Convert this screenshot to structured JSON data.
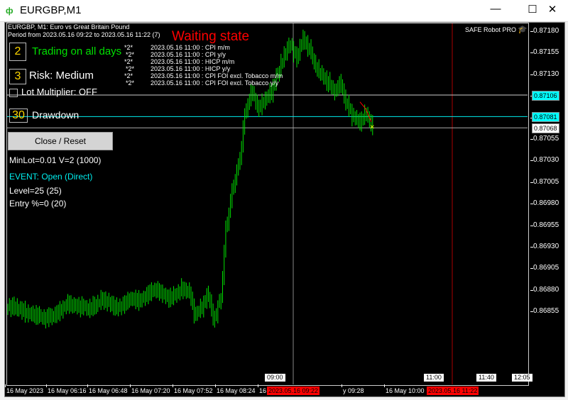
{
  "window": {
    "title": "EURGBP,M1",
    "minimize": "—",
    "maximize": "☐",
    "close": "✕",
    "icon": "candlestick-icon"
  },
  "chart": {
    "symbol_line": "EURGBP, M1:  Euro vs Great Britain Pound",
    "period_line": "Period from  2023.05.16 09:22      to 2023.05.16 11:22   (7)",
    "state": "Waiting state",
    "robot": "SAFE Robot PRO",
    "robot_icon": "graduation-cap-icon",
    "trading_box": "2",
    "trading_label": "Trading on all days",
    "risk_box": "3",
    "risk_label": "Risk: Medium",
    "lot_label": "Lot Multiplier: OFF",
    "dd_box": "30",
    "dd_label": "Drawdown",
    "close_button": "Close / Reset",
    "minlot": "MinLot=0.01    V=2 (1000)",
    "event": "EVENT: Open (Direct)",
    "level": "Level=25 (25)",
    "entry": "Entry %=0 (20)",
    "news": [
      {
        "mark": "*2*",
        "text": "2023.05.16 11:00 : CPI m/m"
      },
      {
        "mark": "*2*",
        "text": "2023.05.16 11:00 : CPI y/y"
      },
      {
        "mark": "*2*",
        "text": "2023.05.16 11:00 : HICP m/m"
      },
      {
        "mark": "*2*",
        "text": "2023.05.16 11:00 : HICP y/y"
      },
      {
        "mark": "*2*",
        "text": "2023.05.16 11:00 : CPI FOI excl. Tobacco m/m"
      },
      {
        "mark": "*2*",
        "text": "2023.05.16 11:00 : CPI FOI excl. Tobacco y/y"
      }
    ],
    "colors": {
      "candle": "#00e000",
      "accent_red": "#ff0000",
      "cyan": "#00ffff",
      "green_text": "#00e000"
    }
  },
  "chart_data": {
    "type": "line",
    "price_ticks": [
      "0.87180",
      "0.87155",
      "0.87130",
      "0.87105",
      "0.87080",
      "0.87055",
      "0.87030",
      "0.87005",
      "0.86980",
      "0.86955",
      "0.86930",
      "0.86905",
      "0.86880",
      "0.86855"
    ],
    "ylim": [
      0.8683,
      0.8719
    ],
    "levels": [
      {
        "label": "0.87106",
        "value": 0.87106,
        "color": "#00ffff"
      },
      {
        "label": "0.87081",
        "value": 0.87081,
        "color": "#00ffff"
      },
      {
        "label": "0.87068",
        "value": 0.87068,
        "color": "#ffffff"
      }
    ],
    "time_labels": [
      "16 May 2023",
      "16 May 06:16",
      "16 May 06:48",
      "16 May 07:20",
      "16 May 07:52",
      "16 May 08:24",
      "16",
      "y 09:28",
      "16 May 10:00"
    ],
    "time_marks": [
      "09:00",
      "11:00",
      "11:40",
      "12:05"
    ],
    "red_time_tags": [
      "2023.05.16 09:22",
      "2023.05.16 11:22"
    ],
    "closes": [
      0.8686,
      0.86858,
      0.86855,
      0.86852,
      0.8685,
      0.86847,
      0.8685,
      0.86852,
      0.86858,
      0.86865,
      0.86862,
      0.8686,
      0.86858,
      0.86862,
      0.86868,
      0.86866,
      0.86862,
      0.8686,
      0.86865,
      0.8687,
      0.86868,
      0.86872,
      0.86878,
      0.8688,
      0.86875,
      0.8687,
      0.86875,
      0.86882,
      0.86878,
      0.8685,
      0.8686,
      0.86875,
      0.86845,
      0.8687,
      0.8696,
      0.87,
      0.8703,
      0.8709,
      0.8711,
      0.8709,
      0.871,
      0.8711,
      0.8713,
      0.8715,
      0.87165,
      0.8715,
      0.8717,
      0.8716,
      0.8714,
      0.8713,
      0.8712,
      0.8711,
      0.8712,
      0.87095,
      0.8708,
      0.87075,
      0.87085,
      0.8707
    ]
  }
}
